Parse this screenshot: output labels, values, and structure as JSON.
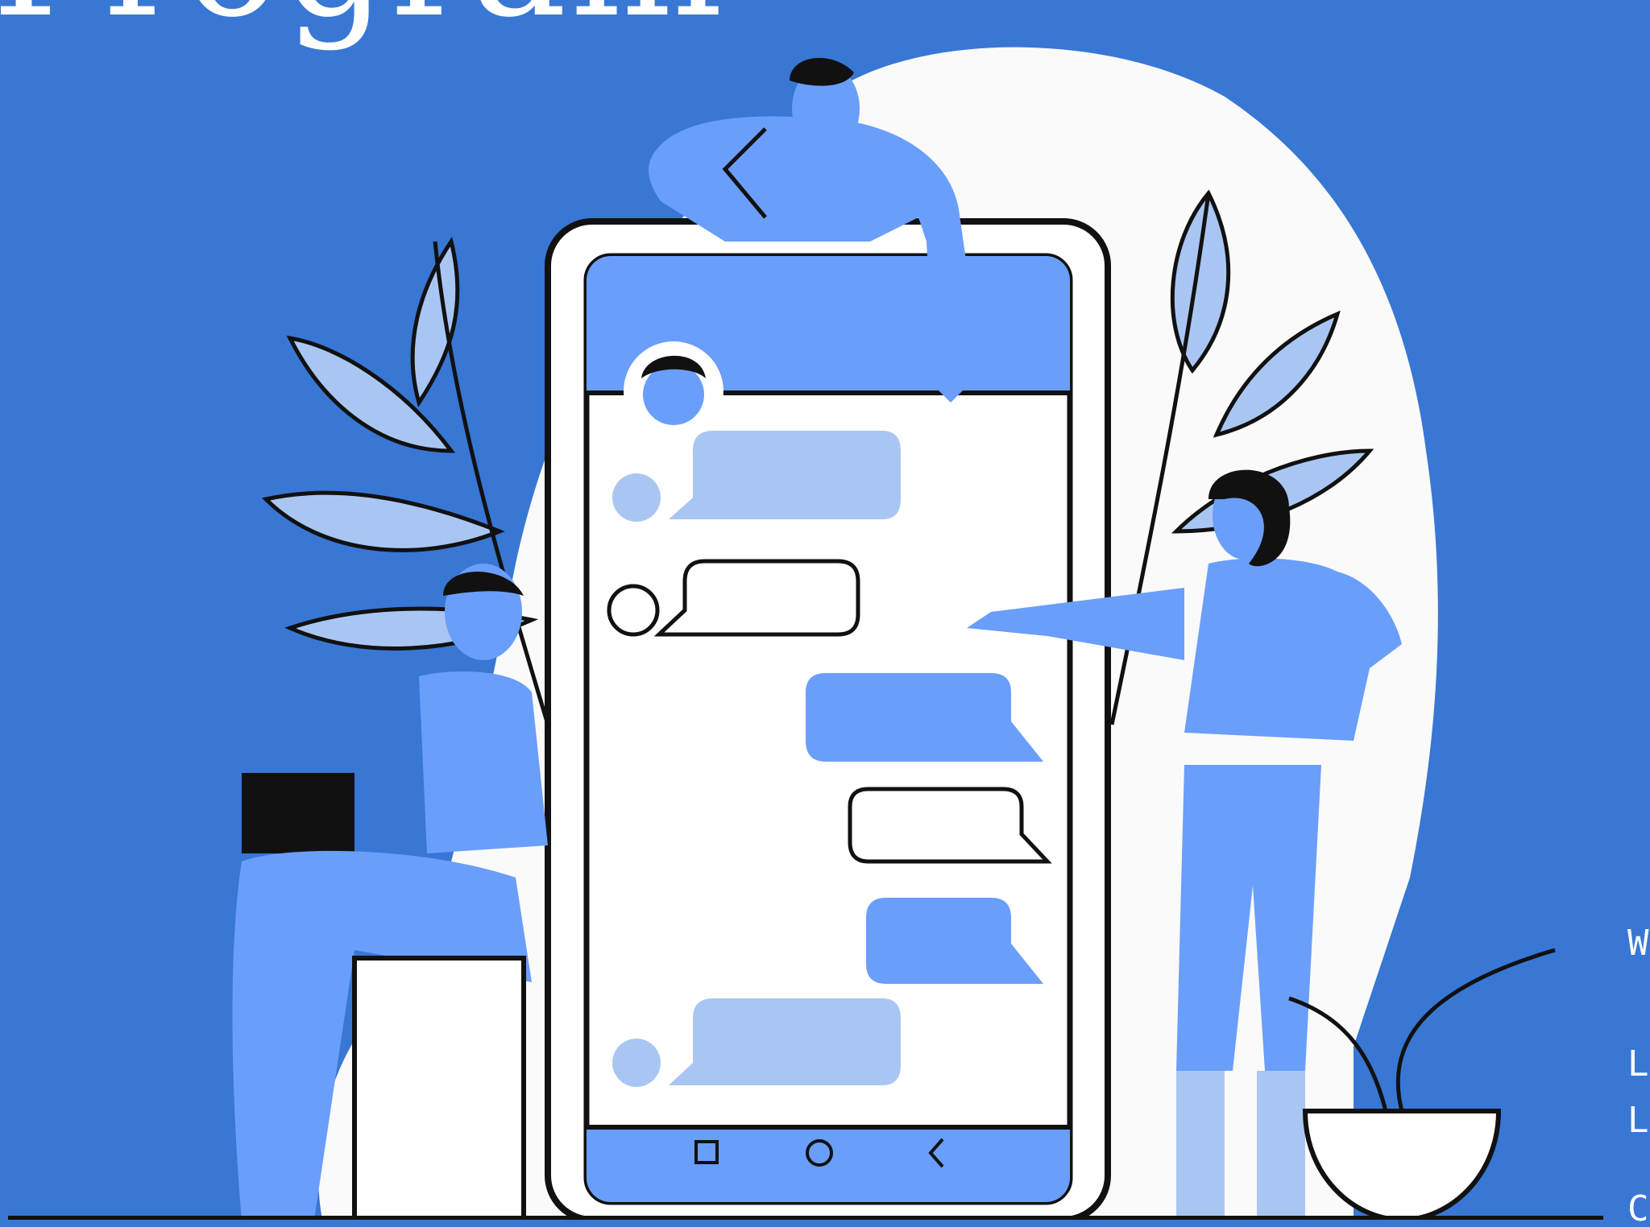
{
  "title": "Program",
  "side_text": [
    "W",
    "L",
    "L",
    "C"
  ],
  "colors": {
    "background": "#3877d4",
    "accent_blue": "#6a9efb",
    "light_blue": "#a9c6f3",
    "white": "#ffffff",
    "ink": "#111111"
  },
  "phone": {
    "nav_icons": [
      "square-icon",
      "circle-icon",
      "chevron-left-icon"
    ]
  }
}
